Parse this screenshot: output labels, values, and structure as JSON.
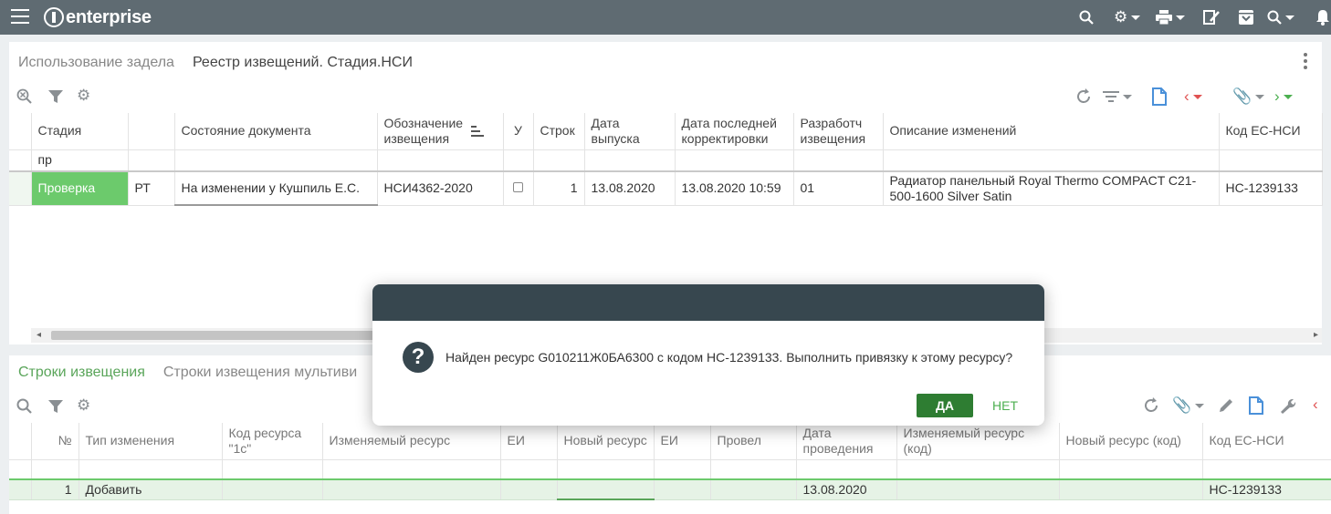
{
  "app": {
    "brand": "enterprise"
  },
  "top_panel": {
    "tabs": [
      {
        "label": "Использование задела"
      },
      {
        "label": "Реестр извещений. Стадия.НСИ"
      }
    ],
    "columns": [
      "Стадия",
      "",
      "Состояние документа",
      "Обозначение извещения",
      "У",
      "Строк",
      "Дата выпуска",
      "Дата последней корректировки",
      "Разработч извещения",
      "Описание изменений",
      "Код ЕС-НСИ"
    ],
    "filter_value": "пр",
    "rows": [
      {
        "stage": "Проверка",
        "type": "РТ",
        "state": "На изменении у  Кушпиль Е.С.",
        "notice_code": "НСИ4362-2020",
        "lines": "1",
        "release_date": "13.08.2020",
        "last_corr": "13.08.2020 10:59",
        "developer": "01",
        "description": "Радиатор панельный Royal Thermo COMPACT C21-500-1600 Silver Satin",
        "code": "НС-1239133"
      }
    ]
  },
  "bottom_panel": {
    "tabs": [
      {
        "label": "Строки извещения"
      },
      {
        "label": "Строки извещения мультиви"
      }
    ],
    "columns": [
      "№",
      "Тип изменения",
      "Код ресурса \"1с\"",
      "Изменяемый ресурс",
      "ЕИ",
      "Новый ресурс",
      "ЕИ",
      "Провел",
      "Дата проведения",
      "Изменяемый ресурс (код)",
      "Новый ресурс (код)",
      "Код ЕС-НСИ"
    ],
    "rows": [
      {
        "num": "1",
        "change_type": "Добавить",
        "date": "13.08.2020",
        "code": "НС-1239133"
      }
    ]
  },
  "dialog": {
    "message": "Найден ресурс G010211Ж0БА6300 с кодом НС-1239133. Выполнить привязку к этому ресурсу?",
    "yes_label": "ДА",
    "no_label": "НЕТ"
  }
}
